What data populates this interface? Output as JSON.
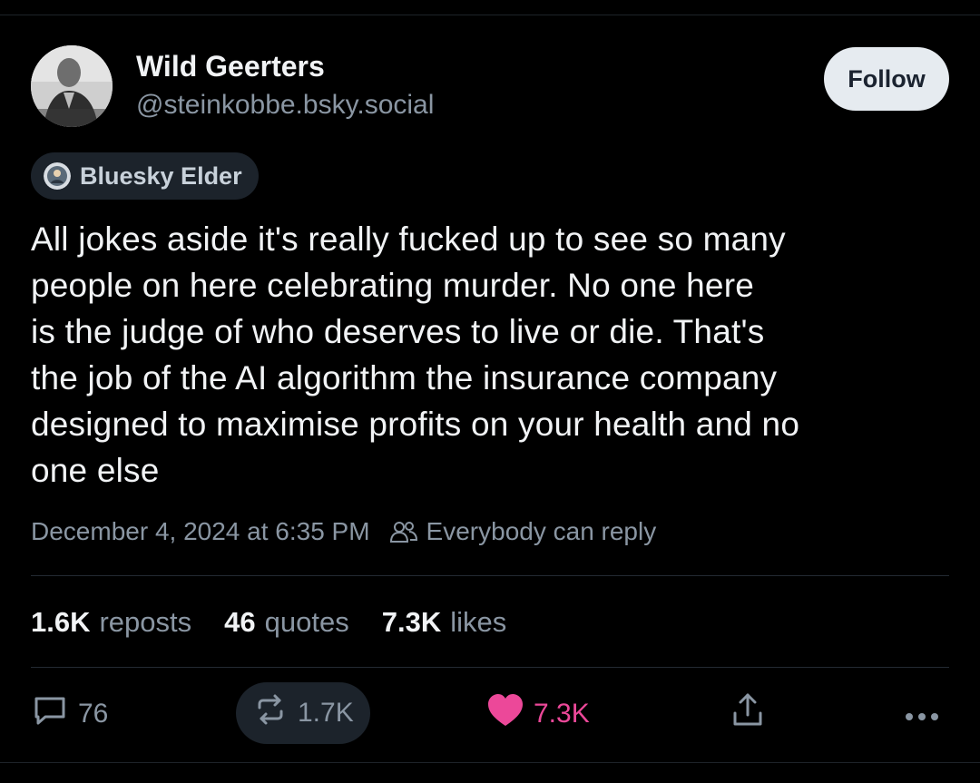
{
  "author": {
    "display_name": "Wild Geerters",
    "handle": "@steinkobbe.bsky.social"
  },
  "follow_label": "Follow",
  "badge": {
    "label": "Bluesky Elder"
  },
  "post": {
    "lines": [
      "All jokes aside it's really fucked up to see so many",
      "people on here celebrating murder. No one here",
      "is the judge of who deserves to live or die. That's",
      "the job of the AI algorithm the insurance company",
      "designed to maximise profits on your health and no",
      "one else"
    ],
    "timestamp": "December 4, 2024 at 6:35 PM",
    "reply_setting": "Everybody can reply"
  },
  "stats": {
    "reposts_count": "1.6K",
    "reposts_label": "reposts",
    "quotes_count": "46",
    "quotes_label": "quotes",
    "likes_count": "7.3K",
    "likes_label": "likes"
  },
  "actions": {
    "reply_count": "76",
    "repost_count": "1.7K",
    "like_count": "7.3K"
  },
  "colors": {
    "background": "#000000",
    "like_accent": "#ec4899",
    "muted_text": "#8a96a3",
    "follow_button_bg": "#e6ebf0"
  },
  "icons": {
    "reply": "speech-bubble-icon",
    "repost": "repost-arrows-icon",
    "like": "heart-icon",
    "share": "share-upload-icon",
    "more": "ellipsis-icon",
    "reply_setting": "people-icon"
  }
}
